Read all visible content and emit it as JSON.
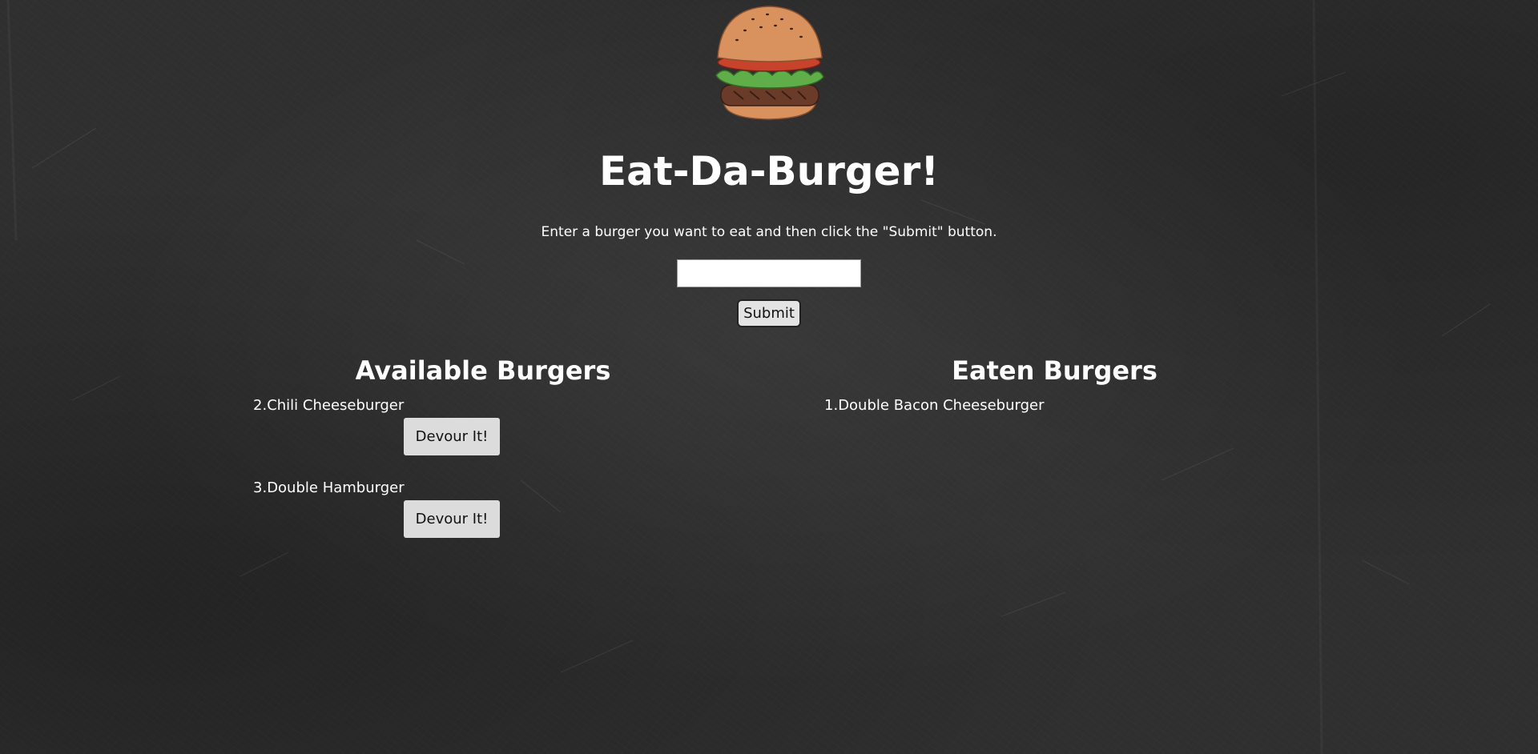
{
  "page": {
    "title": "Eat-Da-Burger!",
    "instructions": "Enter a burger you want to eat and then click the \"Submit\" button.",
    "logo_icon": "burger-icon"
  },
  "form": {
    "input_value": "",
    "submit_label": "Submit"
  },
  "available": {
    "heading": "Available Burgers",
    "items": [
      {
        "number": "2.",
        "name": "Chili Cheeseburger",
        "button_label": "Devour It!"
      },
      {
        "number": "3.",
        "name": "Double Hamburger",
        "button_label": "Devour It!"
      }
    ]
  },
  "eaten": {
    "heading": "Eaten Burgers",
    "items": [
      {
        "number": "1.",
        "name": "Double Bacon Cheeseburger"
      }
    ]
  },
  "colors": {
    "background": "#2f2f2f",
    "text": "#ffffff",
    "button": "#dcdcdc",
    "bun": "#d9915e",
    "tomato": "#c8432b",
    "lettuce": "#5fae4a",
    "patty": "#6b3b2a"
  }
}
